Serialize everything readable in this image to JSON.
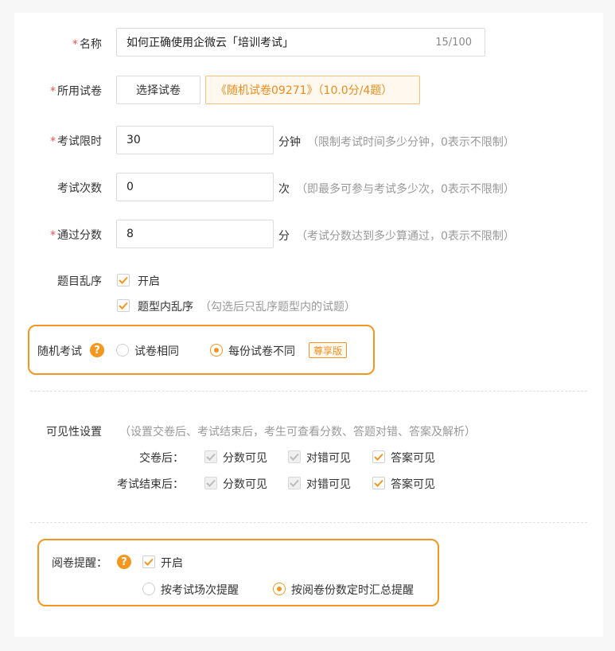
{
  "form": {
    "name": {
      "label": "名称",
      "value": "如何正确使用企微云「培训考试」",
      "count": "15/100"
    },
    "paper": {
      "label": "所用试卷",
      "button": "选择试卷",
      "selected": "《随机试卷09271》（10.0分/4题）"
    },
    "time_limit": {
      "label": "考试限时",
      "value": "30",
      "unit": "分钟",
      "hint": "（限制考试时间多少分钟，0表示不限制）"
    },
    "attempts": {
      "label": "考试次数",
      "value": "0",
      "unit": "次",
      "hint": "（即最多可参与考试多少次，0表示不限制）"
    },
    "pass_score": {
      "label": "通过分数",
      "value": "8",
      "unit": "分",
      "hint": "（考试分数达到多少算通过，0表示不限制）"
    },
    "shuffle": {
      "label": "题目乱序",
      "enable": "开启",
      "inner": "题型内乱序",
      "inner_hint": "（勾选后只乱序题型内的试题）"
    },
    "random_exam": {
      "label": "随机考试",
      "same": "试卷相同",
      "different": "每份试卷不同",
      "badge": "尊享版"
    },
    "visibility": {
      "label": "可见性设置",
      "hint": "（设置交卷后、考试结束后，考生可查看分数、答题对错、答案及解析）",
      "after_submit": "交卷后：",
      "after_end": "考试结束后：",
      "score": "分数可见",
      "correct": "对错可见",
      "answer": "答案可见"
    },
    "grading_reminder": {
      "label": "阅卷提醒：",
      "enable": "开启",
      "per_session": "按考试场次提醒",
      "by_count": "按阅卷份数定时汇总提醒"
    }
  },
  "colors": {
    "accent": "#f5961e",
    "required": "#ff4d4f",
    "hint": "#999999"
  }
}
